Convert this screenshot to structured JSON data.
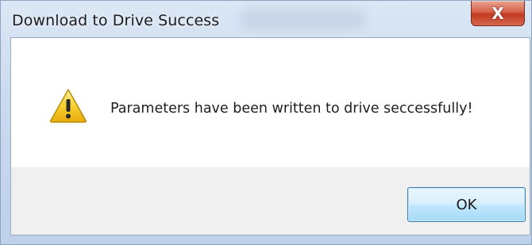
{
  "window": {
    "title": "Download to Drive Success",
    "close_label": "X"
  },
  "dialog": {
    "icon": "warning-icon",
    "message": "Parameters have been written to drive seccessfully!",
    "ok_label": "OK"
  },
  "colors": {
    "title_bar": "#cfdcec",
    "close_button": "#c94a33",
    "ok_button_border": "#3c7fb1",
    "warning_yellow": "#f5c518"
  }
}
